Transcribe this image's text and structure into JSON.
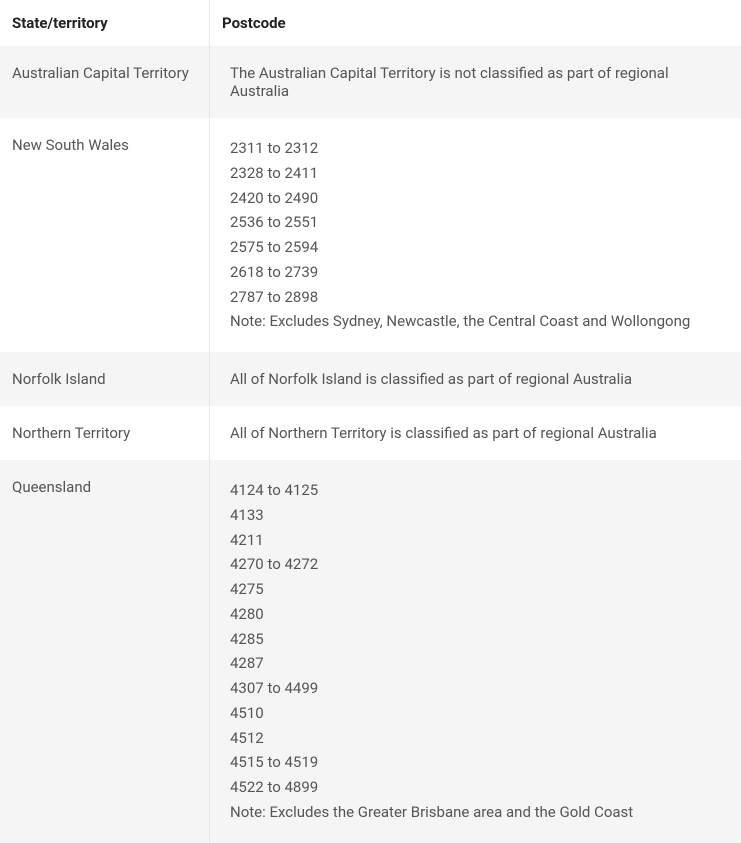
{
  "headers": {
    "state": "State/territory",
    "postcode": "Postcode"
  },
  "rows": [
    {
      "state": "Australian Capital Territory",
      "text": "The Australian Capital Territory is not classified as part of regional Australia"
    },
    {
      "state": "New South Wales",
      "lines": [
        "2311 to 2312",
        "2328 to 2411",
        "2420 to 2490",
        "2536 to 2551",
        "2575 to 2594",
        "2618 to 2739",
        "2787 to 2898"
      ],
      "note": "Note: Excludes Sydney, Newcastle, the Central Coast and Wollongong"
    },
    {
      "state": "Norfolk Island",
      "text": "All of Norfolk Island is classified as part of regional Australia"
    },
    {
      "state": "Northern Territory",
      "text": "All of Northern Territory is classified as part of regional Australia"
    },
    {
      "state": "Queensland",
      "lines": [
        "4124 to 4125",
        "4133",
        "4211",
        "4270 to 4272",
        "4275",
        "4280",
        "4285",
        "4287",
        "4307 to 4499",
        "4510",
        "4512",
        "4515 to 4519",
        "4522 to 4899"
      ],
      "note": "Note: Excludes the Greater Brisbane area and the Gold Coast"
    }
  ]
}
